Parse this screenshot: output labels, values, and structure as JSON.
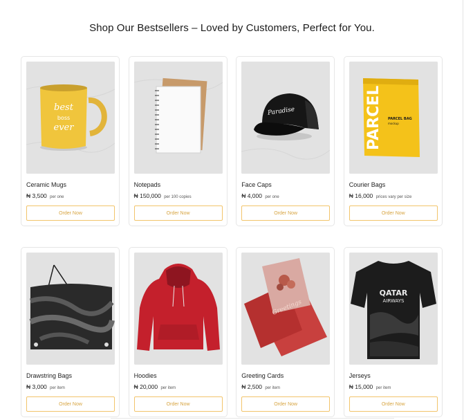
{
  "page": {
    "heading": "Shop Our Bestsellers – Loved by Customers, Perfect for You."
  },
  "products": [
    {
      "name": "Ceramic Mugs",
      "price": "₦ 3,500",
      "note": "per one",
      "button": "Order Now",
      "icon": "mug-image"
    },
    {
      "name": "Notepads",
      "price": "₦ 150,000",
      "note": "per 100 copies",
      "button": "Order Now",
      "icon": "notepad-image"
    },
    {
      "name": "Face Caps",
      "price": "₦ 4,000",
      "note": "per one",
      "button": "Order Now",
      "icon": "cap-image"
    },
    {
      "name": "Courier Bags",
      "price": "₦ 16,000",
      "note": "prices vary per size",
      "button": "Order Now",
      "icon": "courier-bag-image"
    },
    {
      "name": "Drawstring Bags",
      "price": "₦ 3,000",
      "note": "per item",
      "button": "Order Now",
      "icon": "drawstring-bag-image"
    },
    {
      "name": "Hoodies",
      "price": "₦ 20,000",
      "note": "per item",
      "button": "Order Now",
      "icon": "hoodie-image"
    },
    {
      "name": "Greeting Cards",
      "price": "₦ 2,500",
      "note": "per item",
      "button": "Order Now",
      "icon": "greeting-card-image"
    },
    {
      "name": "Jerseys",
      "price": "₦ 15,000",
      "note": "per item",
      "button": "Order Now",
      "icon": "jersey-image"
    }
  ],
  "artwork": {
    "mug": {
      "line1": "best",
      "line2": "boss",
      "line3": "ever"
    },
    "cap": {
      "script": "Paradise"
    },
    "courier": {
      "big": "PARCEL",
      "small1": "PARCEL BAG",
      "small2": "mockup"
    },
    "greeting": {
      "script": "Greetings"
    },
    "jersey": {
      "line1": "QATAR",
      "line2": "AIRWAYS"
    }
  },
  "colors": {
    "accent": "#f2c46a",
    "accent_text": "#d7a440",
    "card_border": "#e6e6e6",
    "image_bg": "#e4e4e4"
  }
}
